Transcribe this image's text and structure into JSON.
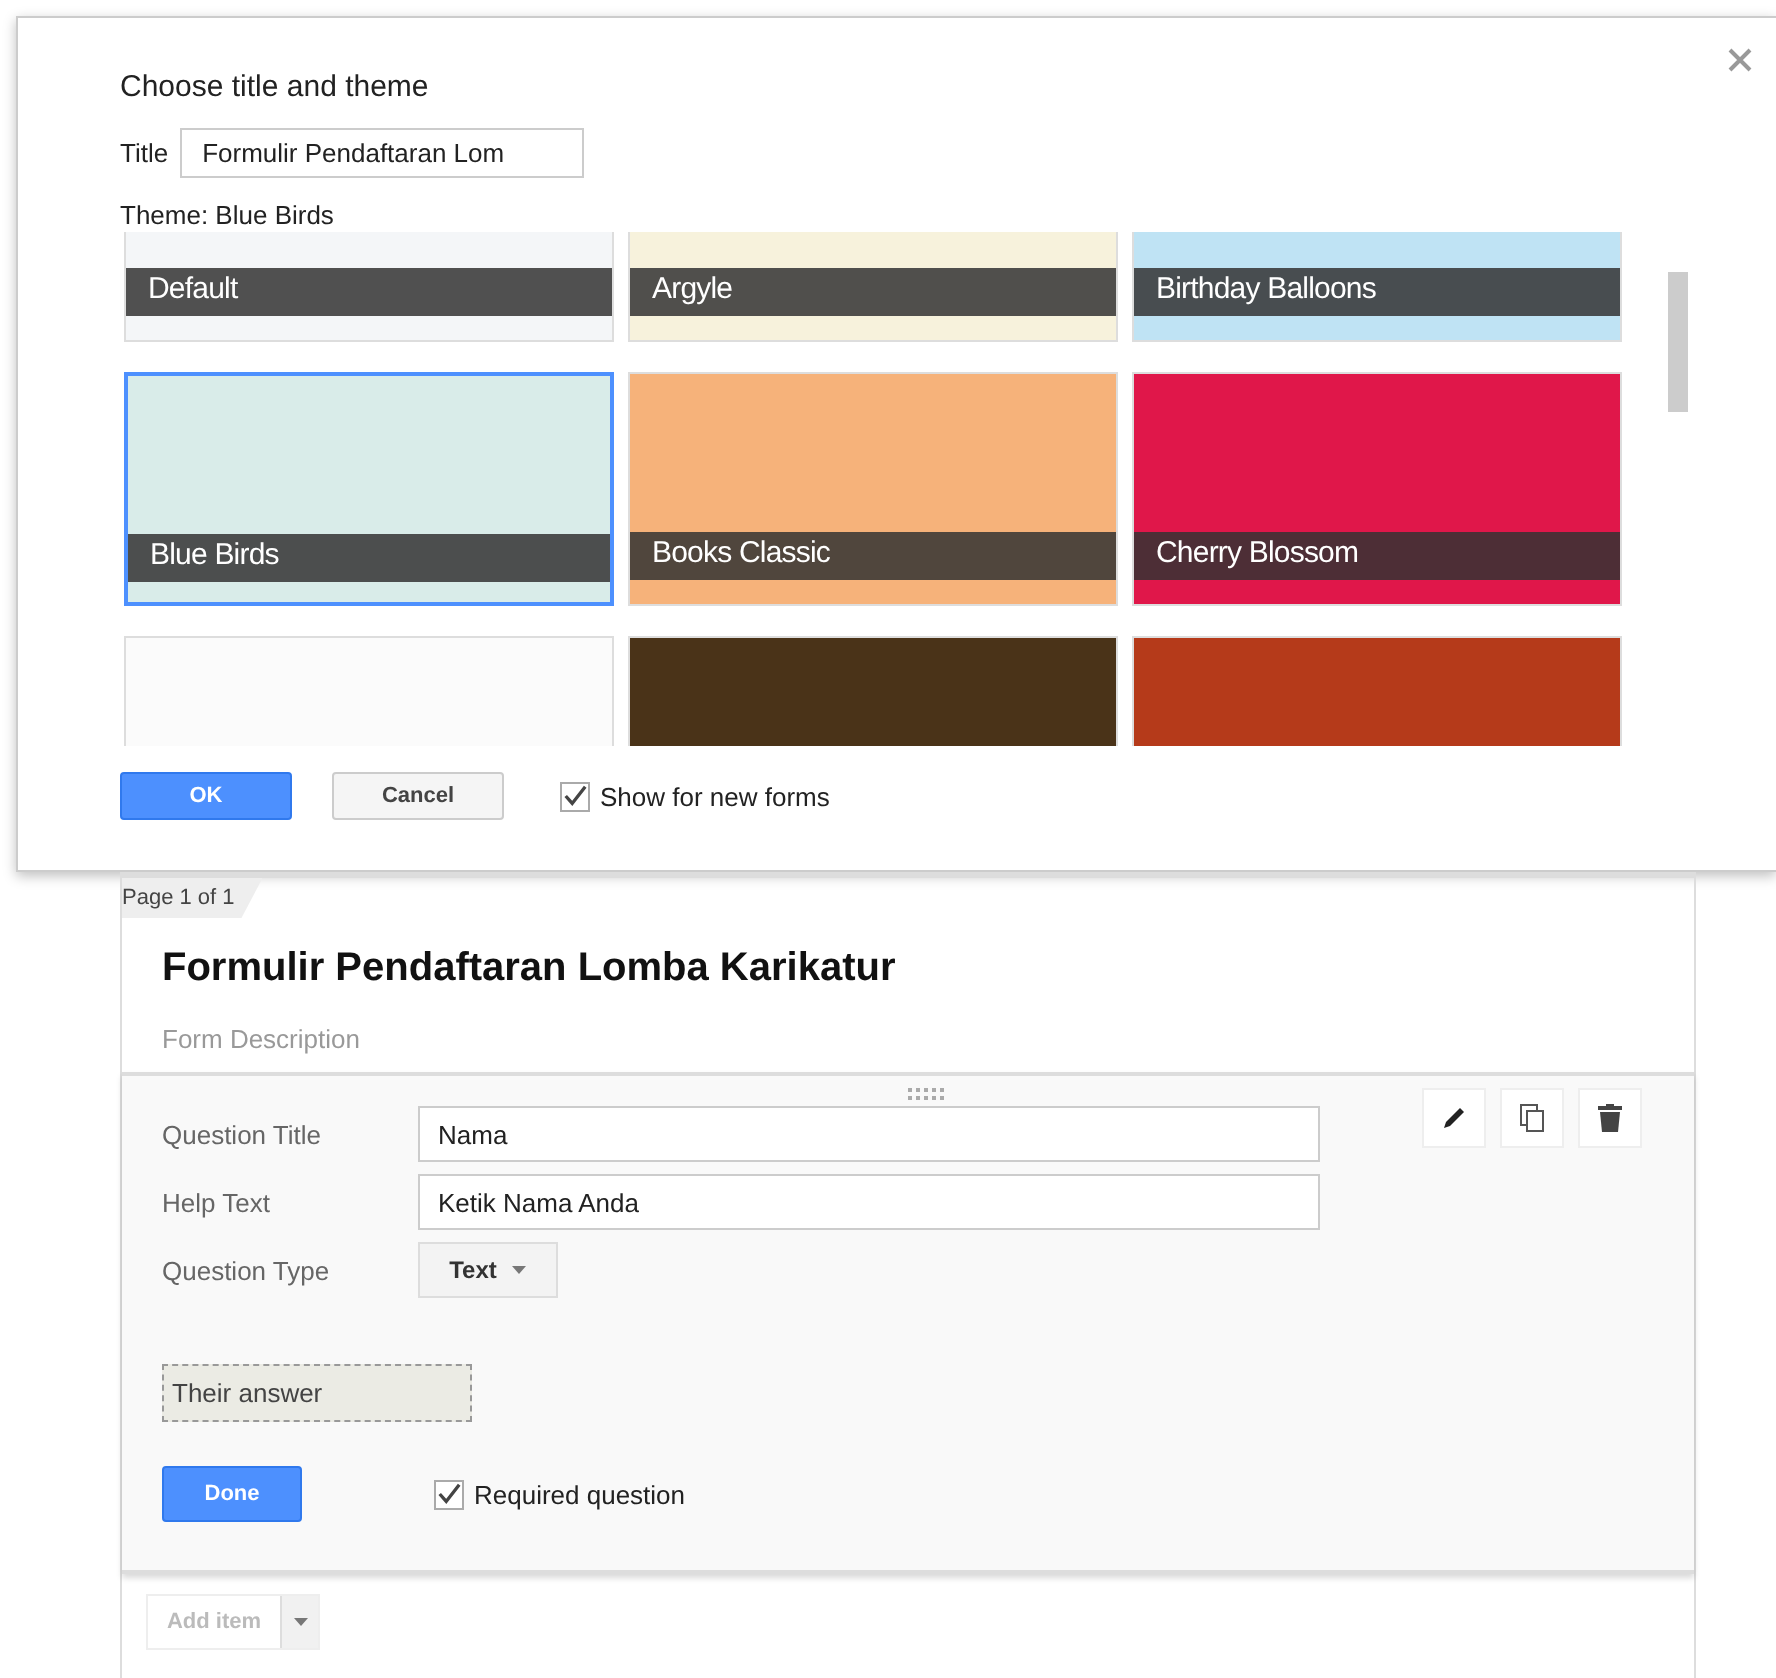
{
  "dialog": {
    "title": "Choose title and theme",
    "title_label": "Title",
    "title_value": "Formulir Pendaftaran Lom",
    "theme_label": "Theme: Blue Birds",
    "themes": [
      {
        "label": "Default",
        "selected": false,
        "color": "#f4f6f8"
      },
      {
        "label": "Argyle",
        "selected": false,
        "color": "#f7f2dc"
      },
      {
        "label": "Birthday Balloons",
        "selected": false,
        "color": "#bfe3f4"
      },
      {
        "label": "Blue Birds",
        "selected": true,
        "color": "#d9ece9"
      },
      {
        "label": "Books Classic",
        "selected": false,
        "color": "#f6b27a"
      },
      {
        "label": "Cherry Blossom",
        "selected": false,
        "color": "#e0174a"
      },
      {
        "selected": false,
        "color": "#fbfbfb"
      },
      {
        "selected": false,
        "color": "#4a3318"
      },
      {
        "selected": false,
        "color": "#b53a1a"
      }
    ],
    "ok": "OK",
    "cancel": "Cancel",
    "show_for_new": {
      "label": "Show for new forms",
      "checked": true
    }
  },
  "editor": {
    "page_tab": "Page 1 of 1",
    "form_title": "Formulir Pendaftaran Lomba Karikatur",
    "description_placeholder": "Form Description",
    "question": {
      "fields": [
        {
          "label": "Question Title",
          "value": "Nama"
        },
        {
          "label": "Help Text",
          "value": "Ketik Nama Anda"
        }
      ],
      "type_label": "Question Type",
      "type_value": "Text",
      "answer_preview": "Their answer",
      "done": "Done",
      "required": {
        "label": "Required question",
        "checked": true
      }
    },
    "add_item": "Add item"
  }
}
